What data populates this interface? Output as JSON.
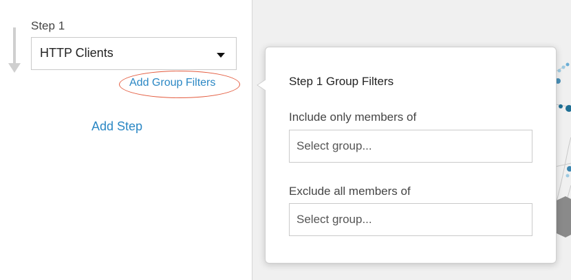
{
  "steps": {
    "step_label": "Step 1",
    "selected_value": "HTTP Clients",
    "add_group_filters": "Add Group Filters",
    "add_step": "Add Step"
  },
  "popover": {
    "title": "Step 1 Group Filters",
    "include_label": "Include only members of",
    "include_placeholder": "Select group...",
    "exclude_label": "Exclude all members of",
    "exclude_placeholder": "Select group..."
  },
  "colors": {
    "link": "#2a87c4",
    "annotation": "#e3593c",
    "graph_node": "#1f6f94"
  },
  "icons": {
    "flow_arrow": "down-arrow-icon",
    "dropdown": "caret-down-icon"
  }
}
